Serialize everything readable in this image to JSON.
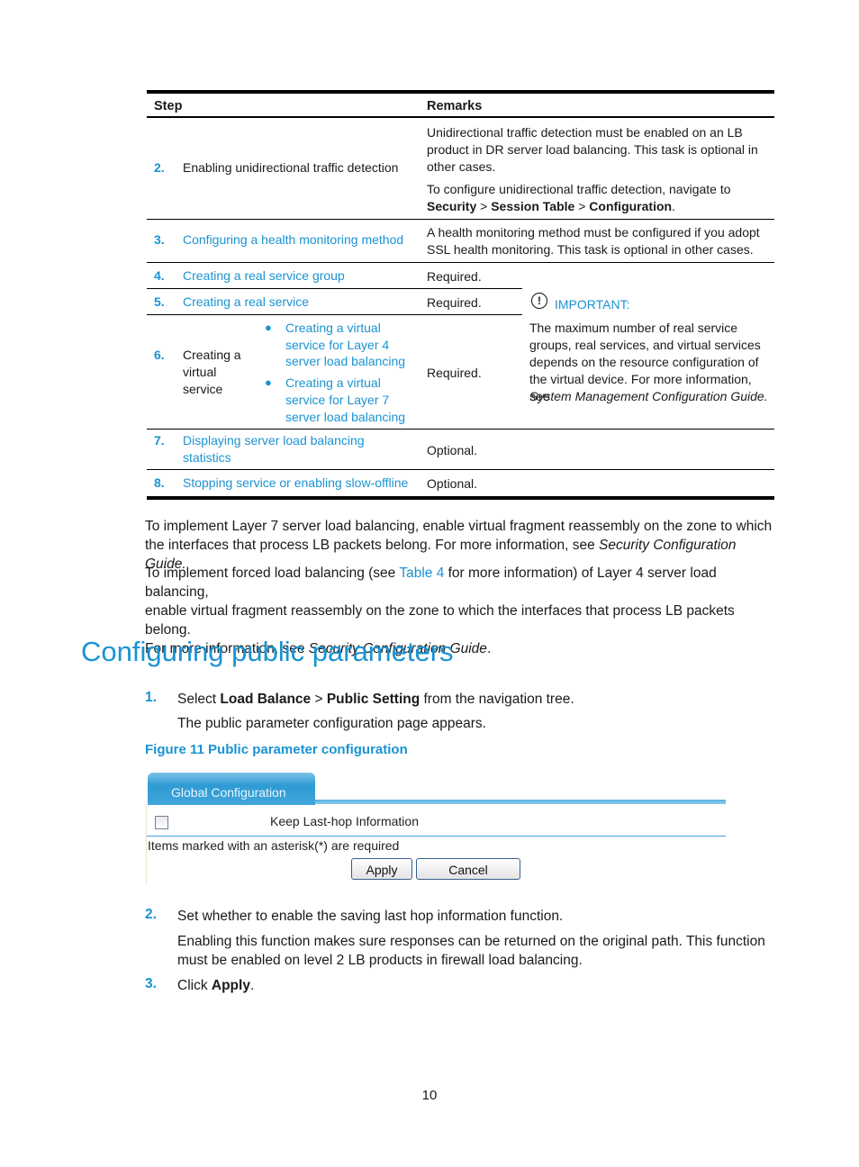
{
  "table": {
    "headers": [
      "Step",
      "Remarks"
    ],
    "rows": [
      {
        "num": "2.",
        "step": "Enabling unidirectional traffic detection",
        "step_is_link": false,
        "remarks": [
          "Unidirectional traffic detection must be enabled on an LB",
          "product in DR server load balancing. This task is optional in",
          "other cases."
        ],
        "remarks2_line1": "To configure unidirectional traffic detection, navigate to",
        "nav_path": [
          "Security",
          "Session Table",
          "Configuration"
        ],
        "nav_sep": ">"
      },
      {
        "num": "3.",
        "step": "Configuring a health monitoring method",
        "step_is_link": true,
        "remarks": [
          "A health monitoring method must be configured if you adopt",
          "SSL health monitoring. This task is optional in other cases."
        ]
      },
      {
        "num": "4.",
        "step": "Creating a real service group",
        "step_is_link": true,
        "remarks": "Required."
      },
      {
        "num": "5.",
        "step": "Creating a real service",
        "step_is_link": true,
        "remarks": "Required."
      },
      {
        "num": "6.",
        "step_lines": [
          "Creating a",
          "virtual",
          "service"
        ],
        "sub_items": [
          [
            "Creating a virtual",
            "service for Layer 4",
            "server load balancing"
          ],
          [
            "Creating a virtual",
            "service for Layer 7",
            "server load balancing"
          ]
        ],
        "remarks": "Required."
      },
      {
        "num": "7.",
        "step_lines": [
          "Displaying server load balancing",
          "statistics"
        ],
        "step_is_link": true,
        "remarks": "Optional."
      },
      {
        "num": "8.",
        "step": "Stopping service or enabling slow-offline",
        "step_is_link": true,
        "remarks": "Optional."
      }
    ],
    "important": {
      "icon": "exclamation-circle",
      "label": "IMPORTANT:",
      "lines": [
        "The maximum number of real service",
        "groups, real services, and virtual services",
        "depends on the resource configuration of",
        "the virtual device. For more information, see"
      ],
      "guide": "System Management Configuration Guide."
    }
  },
  "paragraphs": {
    "p1_line1": "To implement Layer 7 server load balancing, enable virtual fragment reassembly on the zone to which",
    "p1_line2_pre": "the interfaces that process LB packets belong. For more information, see ",
    "p1_line2_italic": "Security Configuration Guide.",
    "p2_line1_pre": "To implement forced load balancing (see ",
    "p2_link": "Table 4",
    "p2_line1_post": " for more information) of Layer 4 server load balancing,",
    "p2_line2": "enable virtual fragment reassembly on the zone to which the interfaces that process LB packets belong.",
    "p2_line3_pre": "For more information, see ",
    "p2_line3_italic": "Security Configuration Guide",
    "p2_line3_post": "."
  },
  "section": {
    "title": "Configuring public parameters",
    "steps": [
      {
        "num": "1.",
        "pre": "Select ",
        "bold1": "Load Balance",
        "sep": " > ",
        "bold2": "Public Setting",
        "post": " from the navigation tree.",
        "sub": "The public parameter configuration page appears."
      },
      {
        "num": "2.",
        "text": "Set whether to enable the saving last hop information function.",
        "sub_line1": "Enabling this function makes sure responses can be returned on the original path. This function",
        "sub_line2": "must be enabled on level 2 LB products in firewall load balancing."
      },
      {
        "num": "3.",
        "pre": "Click ",
        "bold": "Apply",
        "post": "."
      }
    ],
    "figure_caption": "Figure 11 Public parameter configuration"
  },
  "figure_ui": {
    "tab_label": "Global Configuration",
    "checkbox_label": "Keep Last-hop Information",
    "checkbox_checked": false,
    "note": "Items marked with an asterisk(*) are required",
    "apply_label": "Apply",
    "cancel_label": "Cancel"
  },
  "page_number": "10"
}
